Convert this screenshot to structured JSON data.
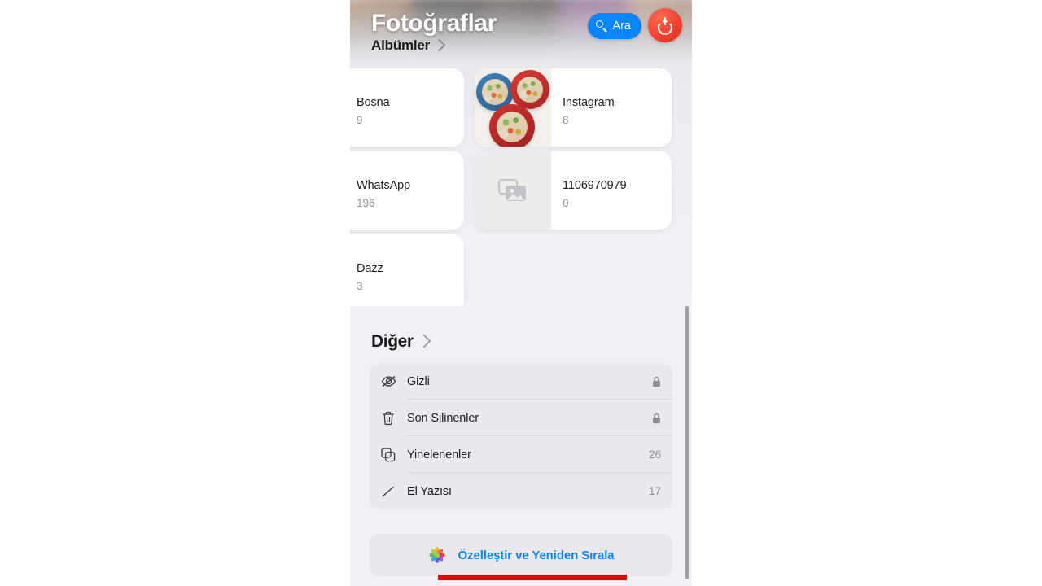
{
  "header": {
    "app_title": "Fotoğraflar",
    "breadcrumb": "Albümler",
    "search_label": "Ara",
    "search_icon": "search-icon",
    "power_icon": "power-icon",
    "chevron_icon": "chevron-right-icon"
  },
  "albums": [
    {
      "name": "Bosna",
      "count": "9",
      "thumb": "blank"
    },
    {
      "name": "Instagram",
      "count": "8",
      "thumb": "photo"
    },
    {
      "name": "WhatsApp",
      "count": "196",
      "thumb": "blank"
    },
    {
      "name": "1106970979",
      "count": "0",
      "thumb": "placeholder"
    },
    {
      "name": "Dazz",
      "count": "3",
      "thumb": "blank"
    }
  ],
  "other": {
    "title": "Diğer",
    "chevron_icon": "chevron-right-icon",
    "rows": [
      {
        "label": "Gizli",
        "icon": "eye-slash-icon",
        "count": "",
        "locked": true
      },
      {
        "label": "Son Silinenler",
        "icon": "trash-icon",
        "count": "",
        "locked": true
      },
      {
        "label": "Yinelenenler",
        "icon": "duplicate-icon",
        "count": "26",
        "locked": false
      },
      {
        "label": "El Yazısı",
        "icon": "scribble-icon",
        "count": "17",
        "locked": false
      }
    ]
  },
  "customize_button": {
    "label": "Özelleştir ve Yeniden Sırala",
    "icon": "photos-app-icon"
  },
  "colors": {
    "accent_blue": "#0a84ff",
    "power_red": "#f03c2e",
    "annotation_red": "#ef0000",
    "list_bg": "#e8e8ed",
    "page_bg": "#f1f1f5",
    "secondary_text": "#8e8e93"
  }
}
